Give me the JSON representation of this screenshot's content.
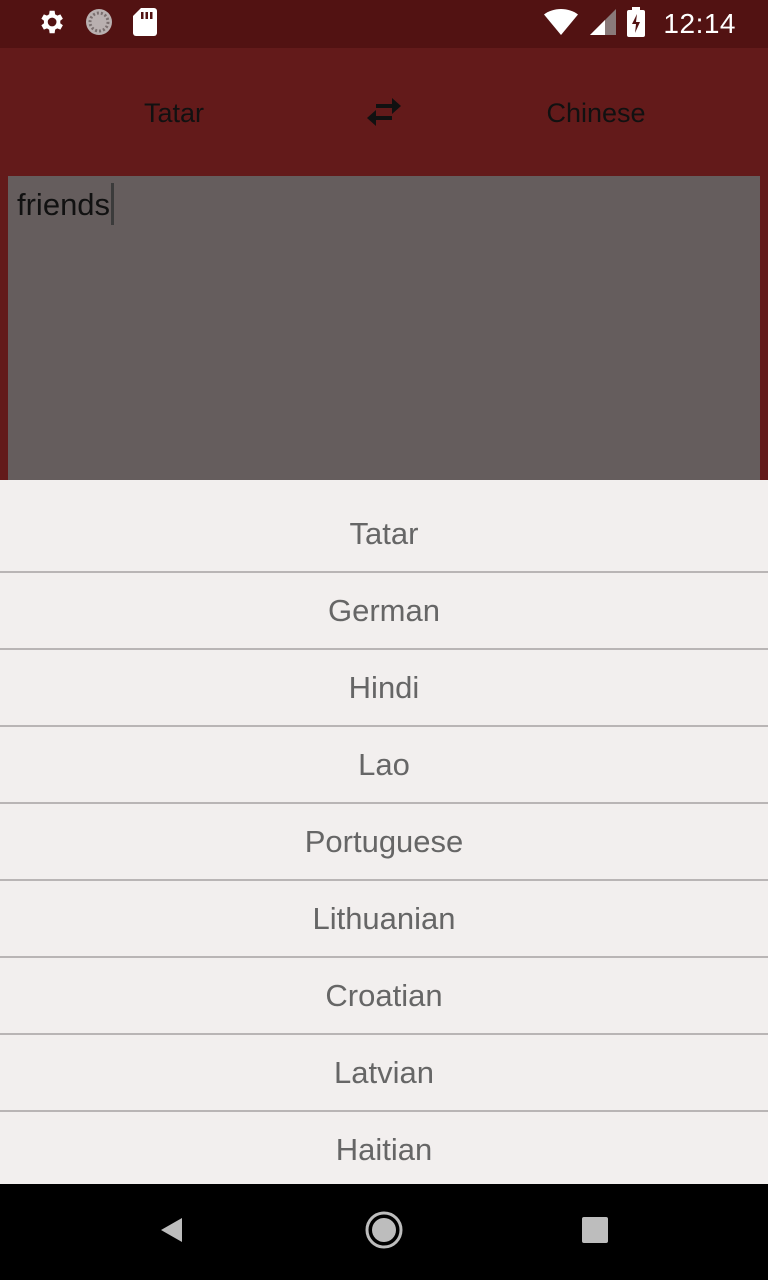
{
  "status_bar": {
    "time": "12:14",
    "icons": [
      "gear-icon",
      "sync-icon",
      "sd-card-icon",
      "wifi-icon",
      "signal-icon",
      "battery-charging-icon"
    ]
  },
  "toolbar": {
    "source_language": "Tatar",
    "target_language": "Chinese",
    "swap_icon": "swap-arrows-icon"
  },
  "input": {
    "value": "friends"
  },
  "language_list": [
    "Tatar",
    "German",
    "Hindi",
    "Lao",
    "Portuguese",
    "Lithuanian",
    "Croatian",
    "Latvian",
    "Haitian"
  ],
  "nav_bar": {
    "icons": [
      "back-icon",
      "home-icon",
      "recents-icon"
    ]
  },
  "colors": {
    "status_bar": "#521212",
    "toolbar": "#631a1a",
    "input_background": "#655d5d",
    "dropdown_background": "#f2efee",
    "dropdown_text": "#666666"
  }
}
